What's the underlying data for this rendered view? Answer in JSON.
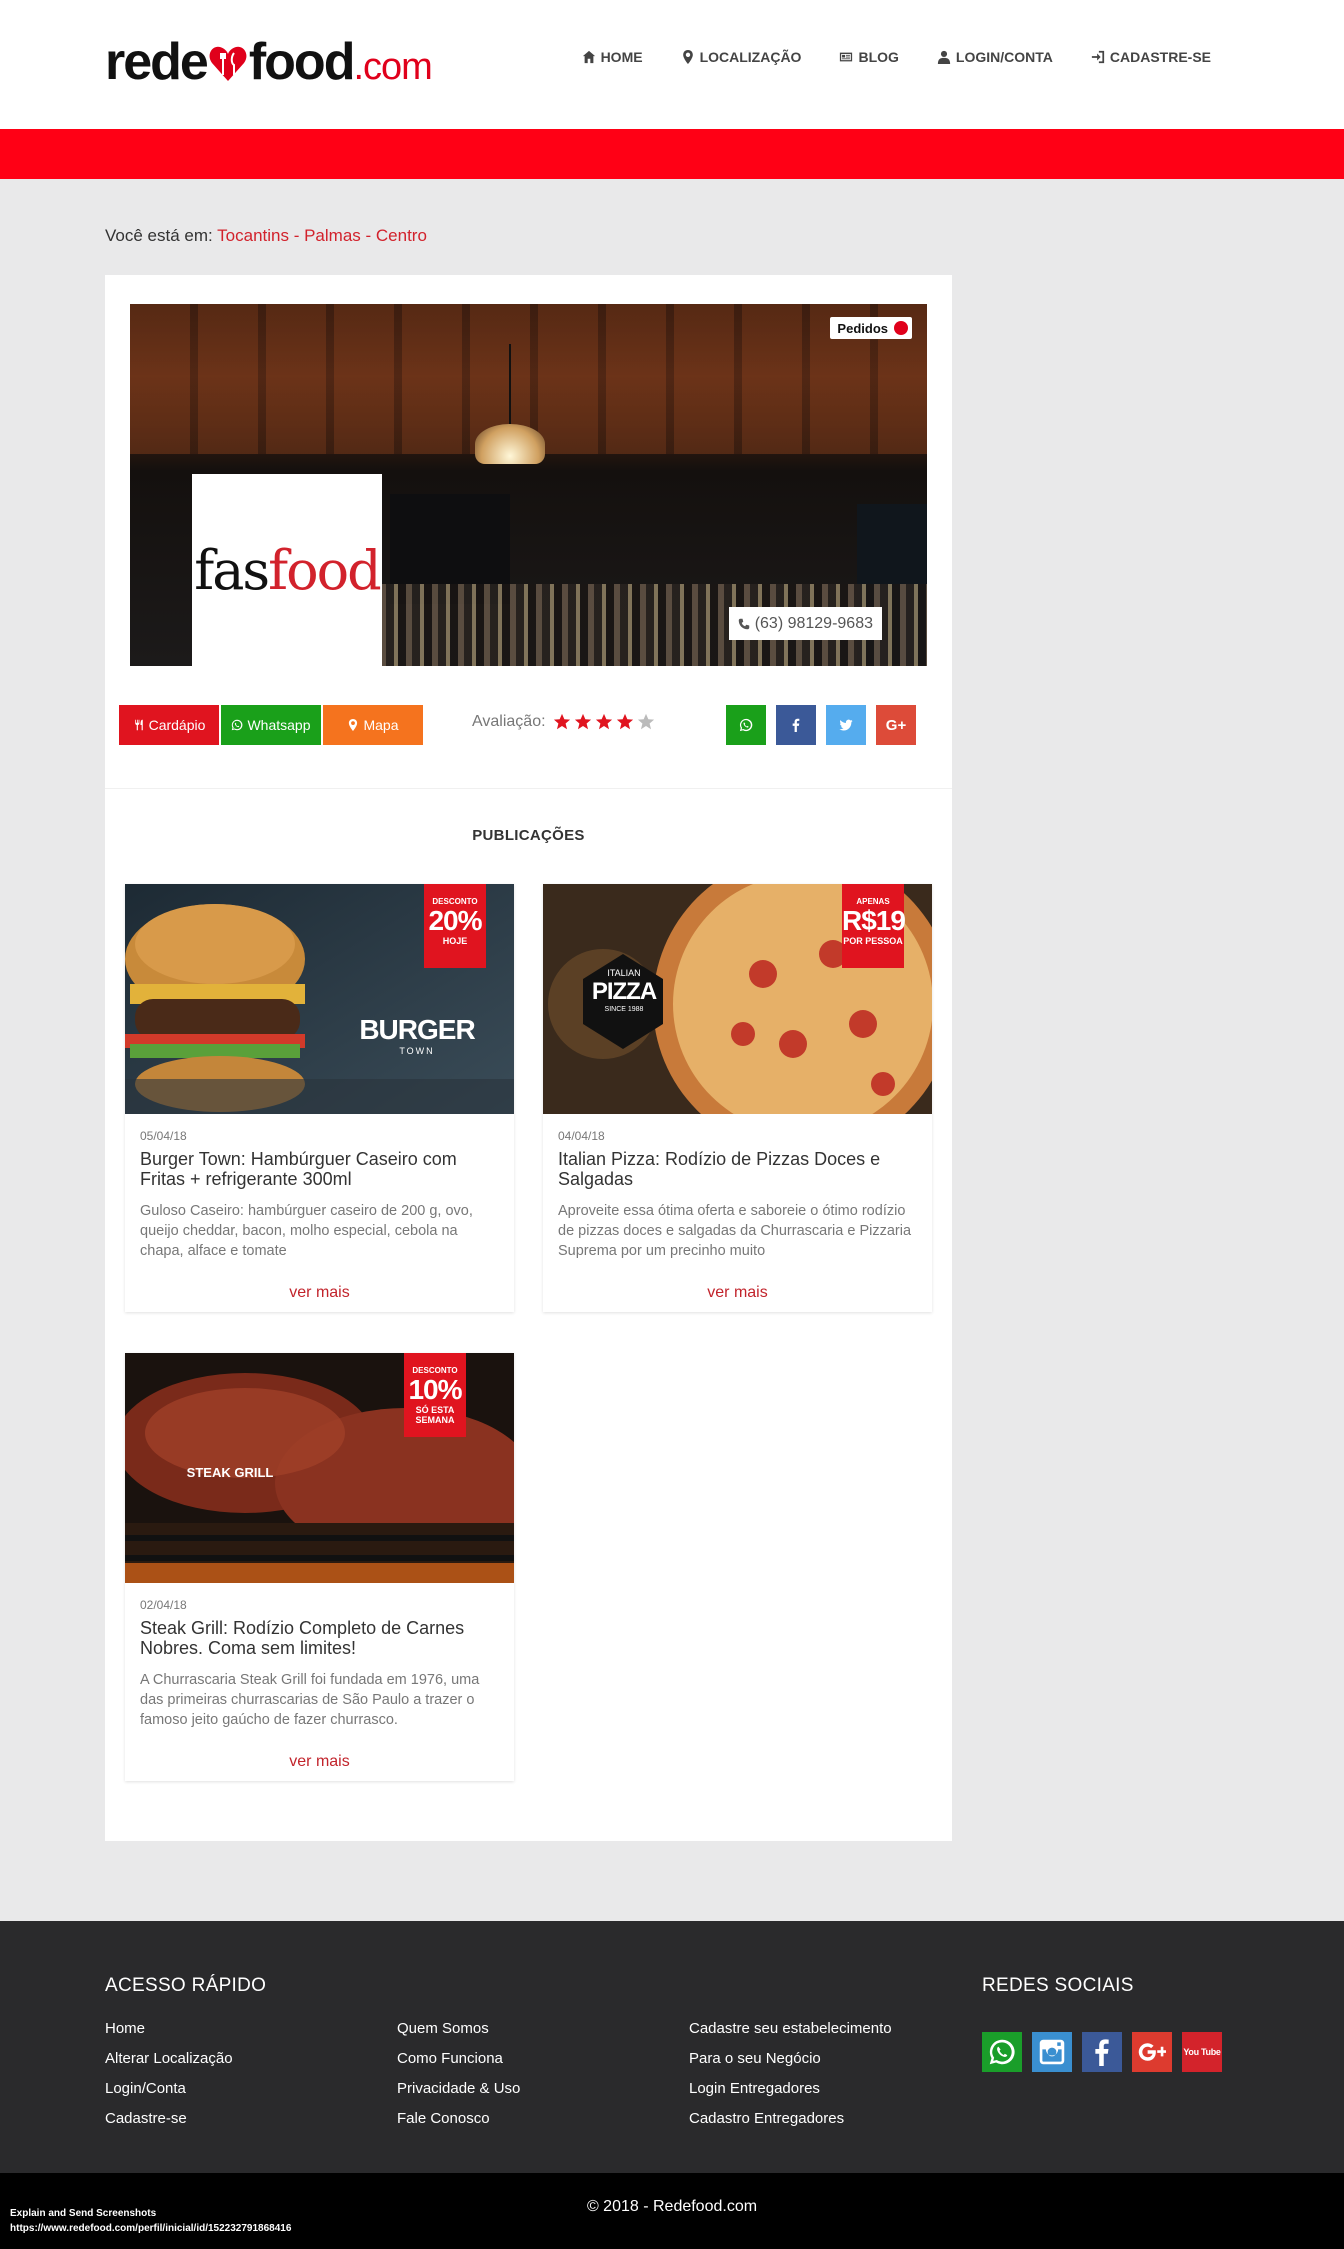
{
  "header": {
    "logo": {
      "part1": "rede",
      "part2": "food",
      "part3": ".com"
    },
    "nav": [
      {
        "label": "HOME",
        "icon": "home-icon"
      },
      {
        "label": "LOCALIZAÇÃO",
        "icon": "map-marker-icon"
      },
      {
        "label": "BLOG",
        "icon": "newspaper-icon"
      },
      {
        "label": "LOGIN/CONTA",
        "icon": "user-icon"
      },
      {
        "label": "CADASTRE-SE",
        "icon": "sign-in-icon"
      }
    ]
  },
  "breadcrumb": {
    "prefix": "Você está em:",
    "state": "Tocantins",
    "sep1": " - ",
    "city": "Palmas",
    "sep2": " - ",
    "district": "Centro"
  },
  "profile": {
    "orders_button": "Pedidos",
    "brand_logo": {
      "part1": "fas",
      "part2": "food"
    },
    "phone": "(63) 98129-9683",
    "buttons": {
      "menu": "Cardápio",
      "whatsapp": "Whatsapp",
      "map": "Mapa"
    },
    "rating_label": "Avaliação:",
    "rating_value": 4,
    "rating_max": 5,
    "share_google_plus": "G+"
  },
  "publications": {
    "title": "PUBLICAÇÕES",
    "more_label": "ver mais",
    "posts": [
      {
        "date": "05/04/18",
        "title": "Burger Town: Hambúrguer Caseiro com Fritas + refrigerante 300ml",
        "text": "Guloso Caseiro: hambúrguer caseiro de 200 g, ovo, queijo cheddar, bacon, molho especial, cebola na chapa, alface e tomate",
        "badge": {
          "top": "DESCONTO",
          "main": "20%",
          "bottom": "HOJE"
        },
        "image_text": {
          "brand": "BURGER",
          "sub": "TOWN"
        }
      },
      {
        "date": "04/04/18",
        "title": "Italian Pizza: Rodízio de Pizzas Doces e Salgadas",
        "text": "Aproveite essa ótima oferta e saboreie o ótimo rodízio de pizzas doces e salgadas da Churrascaria e Pizzaria Suprema por um precinho muito",
        "badge": {
          "top": "APENAS",
          "main": "R$19",
          "bottom": "POR PESSOA"
        },
        "image_text": {
          "pre": "ITALIAN",
          "brand": "PIZZA",
          "sub": "SINCE 1988"
        }
      },
      {
        "date": "02/04/18",
        "title": "Steak Grill: Rodízio Completo de Carnes Nobres. Coma sem limites!",
        "text": "A Churrascaria Steak Grill foi fundada em 1976, uma das primeiras churrascarias de São Paulo a trazer o famoso jeito gaúcho de fazer churrasco.",
        "badge": {
          "top": "DESCONTO",
          "main": "10%",
          "bottom": "SÓ ESTA SEMANA"
        },
        "image_text": {
          "brand": "STEAK GRILL"
        }
      }
    ]
  },
  "footer": {
    "quick_access_title": "ACESSO RÁPIDO",
    "social_title": "REDES SOCIAIS",
    "col1": [
      "Home",
      "Alterar Localização",
      "Login/Conta",
      "Cadastre-se"
    ],
    "col2": [
      "Quem Somos",
      "Como Funciona",
      "Privacidade & Uso",
      "Fale Conosco"
    ],
    "col3": [
      "Cadastre seu estabelecimento",
      "Para o seu Negócio",
      "Login Entregadores",
      "Cadastro Entregadores"
    ],
    "social": [
      {
        "name": "whatsapp-icon",
        "color": "#1a9e2a"
      },
      {
        "name": "instagram-icon",
        "color": "#3a8fd0"
      },
      {
        "name": "facebook-icon",
        "color": "#3b5998"
      },
      {
        "name": "google-plus-icon",
        "color": "#dd3b2f"
      },
      {
        "name": "youtube-icon",
        "color": "#d3232b"
      }
    ],
    "youtube_label": "You Tube"
  },
  "bottom_bar": {
    "copyright": "© 2018 - Redefood.com",
    "extension_line1": "Explain and Send Screenshots",
    "extension_line2": "https://www.redefood.com/perfil/inicial/id/152232791868416"
  },
  "colors": {
    "brand_red": "#ff0015",
    "link_red": "#d2222c",
    "whatsapp_green": "#1aa01a",
    "map_orange": "#f5731e",
    "facebook_blue": "#3b5998",
    "twitter_blue": "#55acee",
    "google_red": "#dd4b39",
    "footer_bg": "#2a2a2c"
  }
}
